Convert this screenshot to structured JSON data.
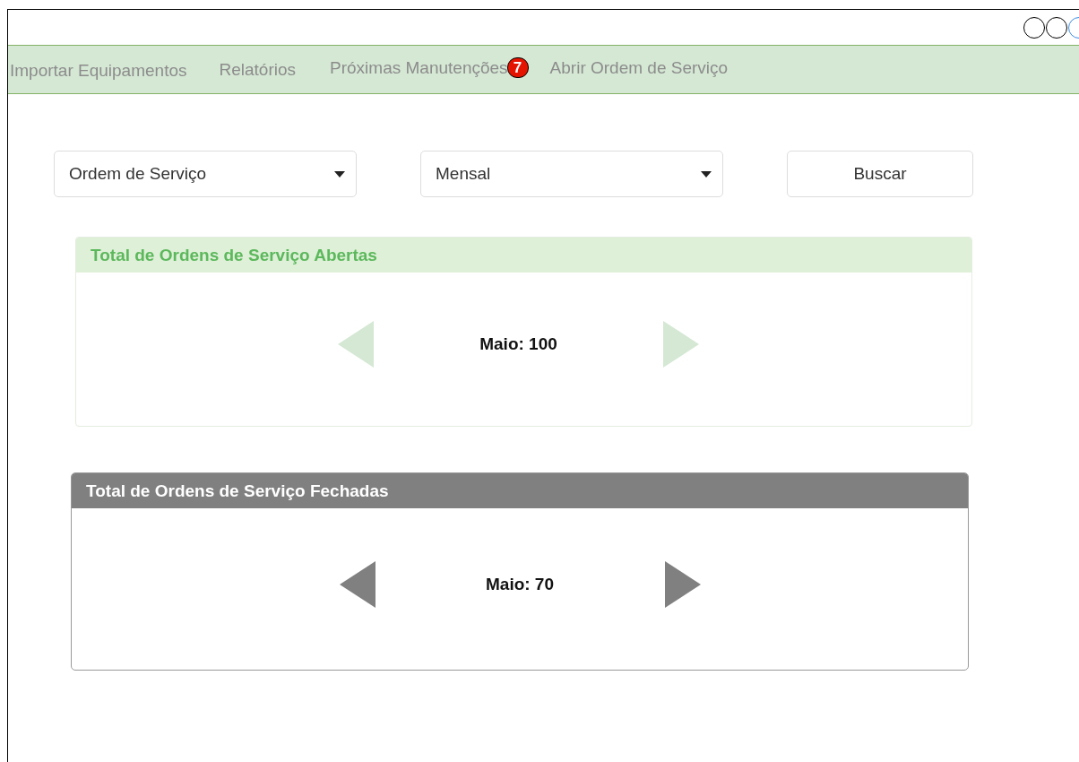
{
  "nav": {
    "items": [
      {
        "label": "Importar Equipamentos"
      },
      {
        "label": "Relatórios"
      },
      {
        "label": "Próximas Manutenções",
        "badge": "7"
      },
      {
        "label": "Abrir Ordem de Serviço"
      }
    ]
  },
  "filters": {
    "dropdowns": [
      {
        "value": "Ordem de Serviço"
      },
      {
        "value": "Mensal"
      }
    ],
    "button": "Buscar"
  },
  "panels": [
    {
      "kind": "success",
      "title": "Total de Ordens de Serviço Abertas",
      "value": "Maio: 100"
    },
    {
      "kind": "default",
      "title": "Total de Ordens de Serviço Fechadas",
      "value": "Maio: 70"
    }
  ]
}
